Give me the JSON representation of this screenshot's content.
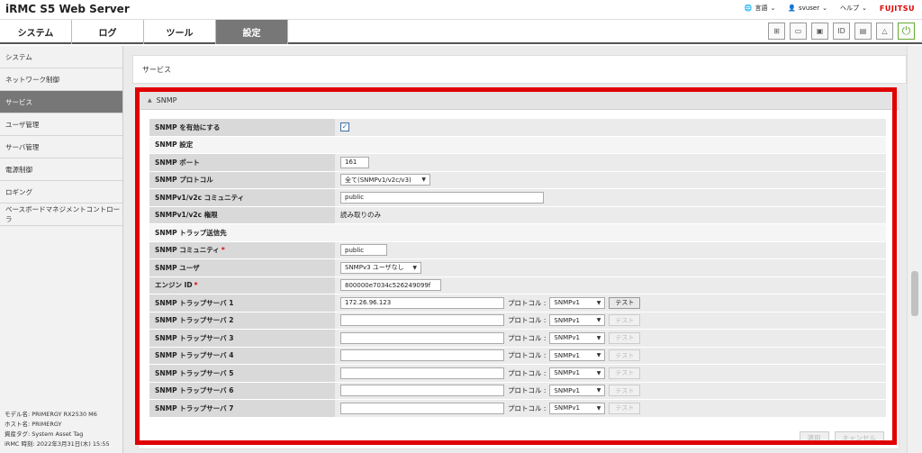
{
  "header": {
    "title": "iRMC S5 Web Server",
    "language_label": "言語",
    "user_label": "svuser",
    "help_label": "ヘルプ",
    "brand": "FUJITSU"
  },
  "tabs": [
    {
      "label": "システム"
    },
    {
      "label": "ログ"
    },
    {
      "label": "ツール"
    },
    {
      "label": "設定",
      "active": true
    }
  ],
  "toolbar_icons": [
    "tree-icon",
    "console-icon",
    "window-icon",
    "id-icon",
    "card-icon",
    "warning-icon",
    "power-icon"
  ],
  "toolbar_labels": {
    "id": "ID"
  },
  "sidebar": {
    "items": [
      {
        "label": "システム"
      },
      {
        "label": "ネットワーク制御"
      },
      {
        "label": "サービス",
        "active": true
      },
      {
        "label": "ユーザ管理"
      },
      {
        "label": "サーバ管理"
      },
      {
        "label": "電源制御"
      },
      {
        "label": "ロギング"
      },
      {
        "label": "ベースボードマネジメントコントローラ"
      }
    ],
    "info": {
      "model": "モデル名: PRIMERGY RX2530 M6",
      "host": "ホスト名: PRIMERGY",
      "asset": "資産タグ: System Asset Tag",
      "time": "iRMC 時刻: 2022年3月31日(木) 15:55"
    }
  },
  "page": {
    "title": "サービス",
    "section_title": "SNMP"
  },
  "form": {
    "enable_label": "SNMP を有効にする",
    "settings_heading": "SNMP 設定",
    "port_label": "SNMP ポート",
    "port_value": "161",
    "protocol_label": "SNMP プロトコル",
    "protocol_value": "全て(SNMPv1/v2c/v3)",
    "community_label": "SNMPv1/v2c コミュニティ",
    "community_value": "public",
    "permission_label": "SNMPv1/v2c 権限",
    "permission_value": "読み取りのみ",
    "trap_heading": "SNMP トラップ送信先",
    "trap_community_label": "SNMP コミュニティ",
    "trap_community_value": "public",
    "trap_user_label": "SNMP ユーザ",
    "trap_user_value": "SNMPv3 ユーザなし",
    "engine_label": "エンジン ID",
    "engine_value": "800000e7034c526249099f",
    "protocol_inline_label": "プロトコル :",
    "test_label": "テスト",
    "trap_servers": [
      {
        "label": "SNMP トラップサーバ 1",
        "value": "172.26.96.123",
        "protocol": "SNMPv1",
        "test_enabled": true
      },
      {
        "label": "SNMP トラップサーバ 2",
        "value": "",
        "protocol": "SNMPv1",
        "test_enabled": false
      },
      {
        "label": "SNMP トラップサーバ 3",
        "value": "",
        "protocol": "SNMPv1",
        "test_enabled": false
      },
      {
        "label": "SNMP トラップサーバ 4",
        "value": "",
        "protocol": "SNMPv1",
        "test_enabled": false
      },
      {
        "label": "SNMP トラップサーバ 5",
        "value": "",
        "protocol": "SNMPv1",
        "test_enabled": false
      },
      {
        "label": "SNMP トラップサーバ 6",
        "value": "",
        "protocol": "SNMPv1",
        "test_enabled": false
      },
      {
        "label": "SNMP トラップサーバ 7",
        "value": "",
        "protocol": "SNMPv1",
        "test_enabled": false
      }
    ]
  },
  "buttons": {
    "apply": "適用",
    "cancel": "キャンセル"
  },
  "colors": {
    "highlight": "#e00000",
    "active_tab": "#777777",
    "brand": "#dd0000"
  }
}
